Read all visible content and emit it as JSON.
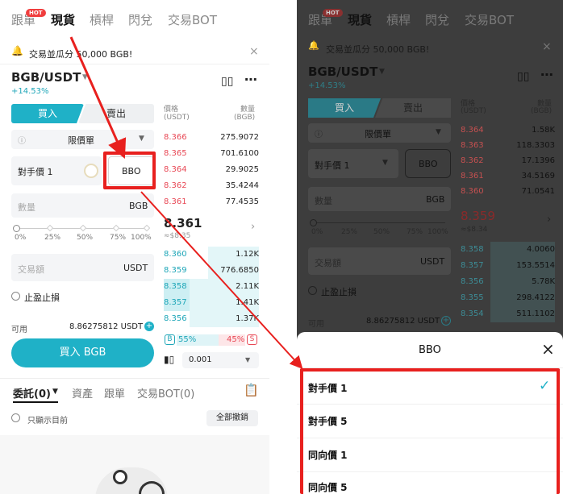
{
  "left": {
    "tabs": [
      "跟單",
      "現貨",
      "槓桿",
      "閃兌",
      "交易BOT"
    ],
    "hot_badge": "HOT",
    "announcement": "交易並瓜分 50,000 BGB!",
    "pair": "BGB/USDT",
    "change": "+14.53%",
    "buy_tab": "買入",
    "sell_tab": "賣出",
    "order_type": "限價單",
    "price_label": "對手價 1",
    "bbo_button": "BBO",
    "qty_placeholder": "數量",
    "qty_unit": "BGB",
    "slider_ticks": [
      "0%",
      "25%",
      "50%",
      "75%",
      "100%"
    ],
    "amount_placeholder": "交易額",
    "amount_unit": "USDT",
    "tpsl_label": "止盈止損",
    "available_label": "可用",
    "available_value": "8.86275812 USDT",
    "buy_button": "買入 BGB",
    "ob_header_price": "價格",
    "ob_header_price_unit": "(USDT)",
    "ob_header_size": "數量",
    "ob_header_size_unit": "(BGB)",
    "asks": [
      {
        "price": "8.366",
        "size": "275.9072"
      },
      {
        "price": "8.365",
        "size": "701.6100"
      },
      {
        "price": "8.364",
        "size": "29.9025"
      },
      {
        "price": "8.362",
        "size": "35.4244"
      },
      {
        "price": "8.361",
        "size": "77.4535"
      }
    ],
    "last_price": "8.361",
    "last_price_fiat": "≈$8.35",
    "bids": [
      {
        "price": "8.360",
        "size": "1.12K"
      },
      {
        "price": "8.359",
        "size": "776.6850"
      },
      {
        "price": "8.358",
        "size": "2.11K"
      },
      {
        "price": "8.357",
        "size": "1.41K"
      },
      {
        "price": "8.356",
        "size": "1.37K"
      }
    ],
    "buy_ratio_label": "B",
    "buy_ratio": "55%",
    "sell_ratio": "45%",
    "sell_ratio_label": "S",
    "depth_precision": "0.001",
    "bottom_tabs": [
      "委託(0)",
      "資產",
      "跟單",
      "交易BOT(0)"
    ],
    "only_current_label": "只顯示目前",
    "cancel_all": "全部撤銷"
  },
  "right": {
    "tabs": [
      "跟單",
      "現貨",
      "槓桿",
      "閃兌",
      "交易BOT"
    ],
    "hot_badge": "HOT",
    "announcement": "交易並瓜分 50,000 BGB!",
    "pair": "BGB/USDT",
    "change": "+14.53%",
    "buy_tab": "買入",
    "sell_tab": "賣出",
    "order_type": "限價單",
    "price_label": "對手價 1",
    "bbo_button": "BBO",
    "qty_placeholder": "數量",
    "qty_unit": "BGB",
    "slider_ticks": [
      "0%",
      "25%",
      "50%",
      "75%",
      "100%"
    ],
    "amount_placeholder": "交易額",
    "amount_unit": "USDT",
    "tpsl_label": "止盈止損",
    "available_label": "可用",
    "available_value": "8.86275812 USDT",
    "ob_header_price": "價格",
    "ob_header_price_unit": "(USDT)",
    "ob_header_size": "數量",
    "ob_header_size_unit": "(BGB)",
    "asks": [
      {
        "price": "8.364",
        "size": "1.58K"
      },
      {
        "price": "8.363",
        "size": "118.3303"
      },
      {
        "price": "8.362",
        "size": "17.1396"
      },
      {
        "price": "8.361",
        "size": "34.5169"
      },
      {
        "price": "8.360",
        "size": "71.0541"
      }
    ],
    "last_price": "8.359",
    "last_price_fiat": "≈$8.34",
    "bids": [
      {
        "price": "8.358",
        "size": "4.0060"
      },
      {
        "price": "8.357",
        "size": "153.5514"
      },
      {
        "price": "8.356",
        "size": "5.78K"
      },
      {
        "price": "8.355",
        "size": "298.4122"
      },
      {
        "price": "8.354",
        "size": "511.1102"
      }
    ],
    "sheet_title": "BBO",
    "sheet_options": [
      "對手價 1",
      "對手價 5",
      "同向價 1",
      "同向價 5"
    ]
  },
  "colors": {
    "accent": "#1fb1c7",
    "ask": "#e84855",
    "highlight": "#e8201e"
  }
}
